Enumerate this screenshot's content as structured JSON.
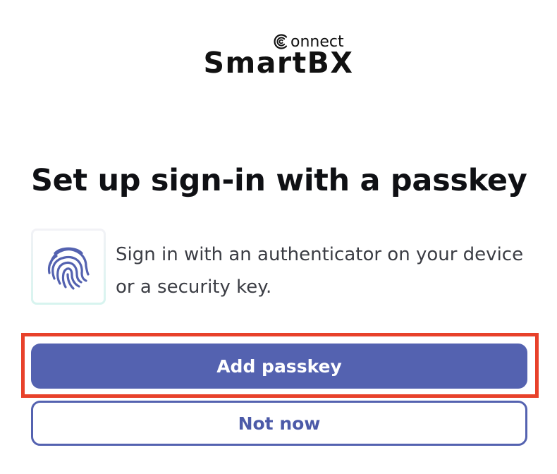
{
  "brand": {
    "name": "SmartBX",
    "sub": "onnect",
    "sub_icon": "c-ring-icon"
  },
  "title": "Set up sign-in with a passkey",
  "authenticator": {
    "icon": "fingerprint-icon",
    "description": "Sign in with an authenticator on your device or a security key."
  },
  "actions": {
    "primary_label": "Add passkey",
    "secondary_label": "Not now"
  },
  "colors": {
    "primary": "#5462b0",
    "highlight": "#e8412a",
    "title": "#0f1014",
    "body_text": "#3b3d44"
  }
}
